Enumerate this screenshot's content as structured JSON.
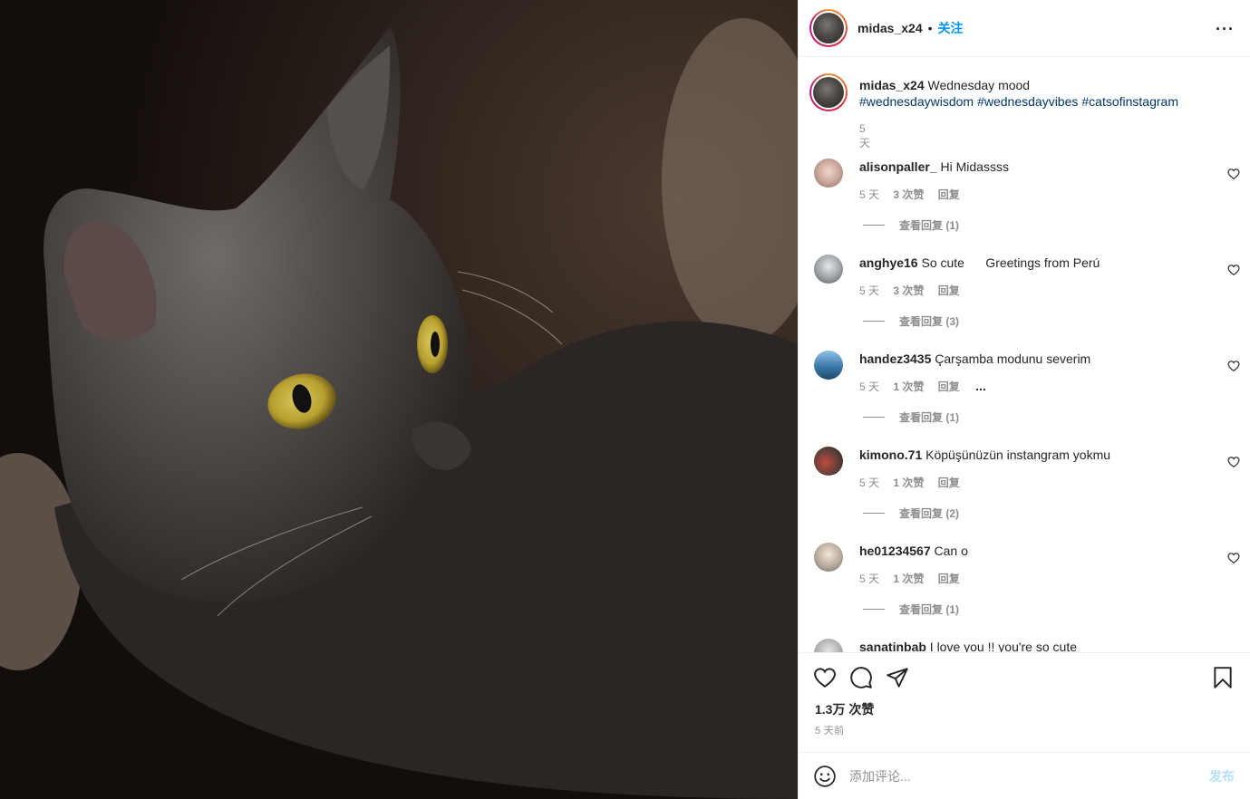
{
  "header": {
    "username": "midas_x24",
    "separator": "•",
    "follow_label": "关注",
    "more_label": "···"
  },
  "caption": {
    "username": "midas_x24",
    "text": "Wednesday mood",
    "hashtags": [
      "#wednesdaywisdom",
      "#wednesdayvibes",
      "#catsofinstagram"
    ],
    "time": "5 天"
  },
  "comments": [
    {
      "username": "alisonpaller_",
      "text": "Hi Midassss",
      "time": "5 天",
      "likes": "3 次赞",
      "reply_label": "回复",
      "view_replies": "查看回复 (1)",
      "avatar_color": "#c9a79a"
    },
    {
      "username": "anghye16",
      "text": "So cute      Greetings from Perú",
      "time": "5 天",
      "likes": "3 次赞",
      "reply_label": "回复",
      "view_replies": "查看回复 (3)",
      "avatar_color": "#9aa0a4"
    },
    {
      "username": "handez3435",
      "text": "Çarşamba modunu severim",
      "time": "5 天",
      "likes": "1 次赞",
      "reply_label": "回复",
      "more": "...",
      "view_replies": "查看回复 (1)",
      "avatar_color": "#3d79a8"
    },
    {
      "username": "kimono.71",
      "text": "Köpüşünüzün instangram yokmu",
      "time": "5 天",
      "likes": "1 次赞",
      "reply_label": "回复",
      "view_replies": "查看回复 (2)",
      "avatar_color": "#5e3f3a"
    },
    {
      "username": "he01234567",
      "text": "Can o",
      "time": "5 天",
      "likes": "1 次赞",
      "reply_label": "回复",
      "view_replies": "查看回复 (1)",
      "avatar_color": "#b8a999"
    },
    {
      "username": "sanatinbab",
      "text": "I love you !! you're so cute",
      "avatar_color": "#a8a8a8"
    }
  ],
  "actions": {
    "likes": "1.3万 次赞",
    "time": "5 天前"
  },
  "add_comment": {
    "placeholder": "添加评论...",
    "publish_label": "发布"
  },
  "colors": {
    "accent": "#0095f6",
    "muted": "#8e8e8e",
    "hashtag": "#00376b",
    "publish_disabled": "#b2dffc"
  }
}
